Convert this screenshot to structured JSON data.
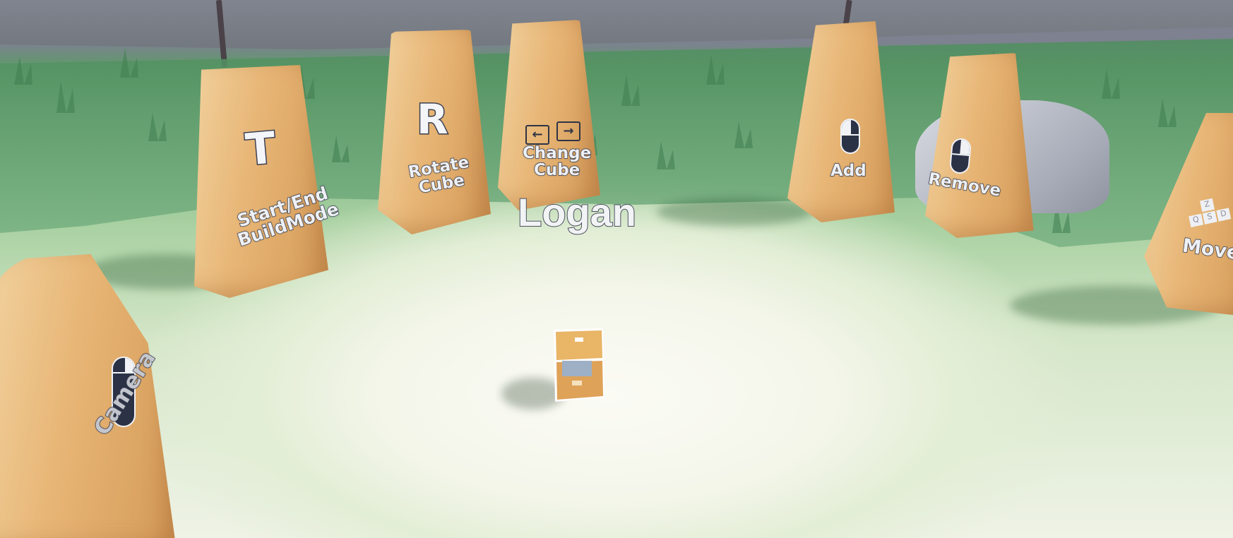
{
  "player": {
    "name": "Logan"
  },
  "signs": {
    "build_mode": {
      "key": "T",
      "label_line1": "Start/End",
      "label_line2": "BuildMode"
    },
    "rotate": {
      "key": "R",
      "label_line1": "Rotate",
      "label_line2": "Cube"
    },
    "change": {
      "key_left": "←",
      "key_right": "→",
      "label_line1": "Change",
      "label_line2": "Cube"
    },
    "add": {
      "icon": "mouse-left-click-icon",
      "label": "Add"
    },
    "remove": {
      "icon": "mouse-right-click-icon",
      "label": "Remove"
    },
    "move": {
      "keys": [
        "Z",
        "Q",
        "S",
        "D"
      ],
      "label": "Move"
    },
    "camera": {
      "icon": "mouse-right-click-icon",
      "label": "Camera"
    }
  },
  "colors": {
    "rock": "#e7b575",
    "grass": "#6fab78",
    "ground": "#f1f4e8",
    "sky_wall": "#7d8190",
    "text_outline": "#3b4152"
  }
}
